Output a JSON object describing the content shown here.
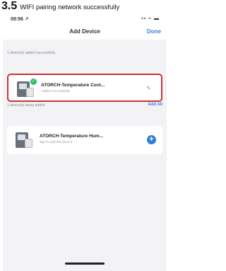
{
  "caption": {
    "number": "3.5",
    "text": "WIFI pairing network successfully"
  },
  "status_bar": {
    "time": "09:56 ↗",
    "icons": "▪▪ ≈ ▬"
  },
  "nav": {
    "title": "Add Device",
    "done_label": "Done"
  },
  "added_section": {
    "label": "1 device(s) added successfully",
    "device": {
      "name": "ATORCH-Temperature Cont...",
      "status": "Added successfully",
      "icon": "edit-icon"
    }
  },
  "pending_section": {
    "label": "1 device(s) being added",
    "action_label": "Add All",
    "device": {
      "name": "ATORCH-Temperature Hum...",
      "status": "Tap to add this device",
      "icon": "add-icon"
    }
  },
  "colors": {
    "accent": "#3c7fd8",
    "highlight_border": "#c8333b",
    "success": "#2fbf5f"
  }
}
